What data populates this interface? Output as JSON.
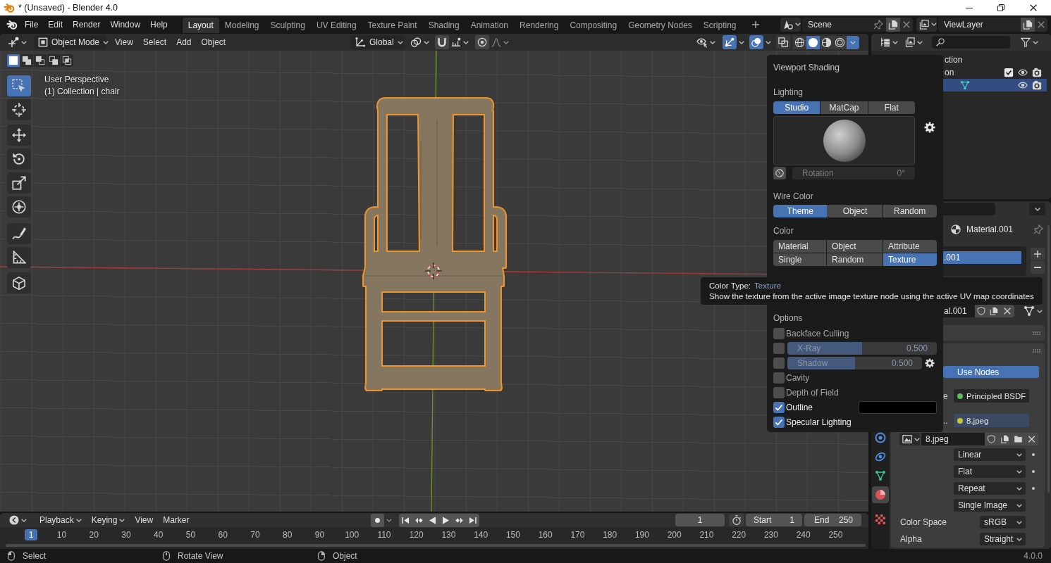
{
  "window": {
    "title": "* (Unsaved) - Blender 4.0"
  },
  "menus": [
    "File",
    "Edit",
    "Render",
    "Window",
    "Help"
  ],
  "workspace_tabs": [
    {
      "label": "Layout",
      "selected": true
    },
    {
      "label": "Modeling",
      "selected": false
    },
    {
      "label": "Sculpting",
      "selected": false
    },
    {
      "label": "UV Editing",
      "selected": false
    },
    {
      "label": "Texture Paint",
      "selected": false
    },
    {
      "label": "Shading",
      "selected": false
    },
    {
      "label": "Animation",
      "selected": false
    },
    {
      "label": "Rendering",
      "selected": false
    },
    {
      "label": "Compositing",
      "selected": false
    },
    {
      "label": "Geometry Nodes",
      "selected": false
    },
    {
      "label": "Scripting",
      "selected": false
    }
  ],
  "scene": {
    "value": "Scene"
  },
  "view_layer": {
    "value": "ViewLayer"
  },
  "viewport_header": {
    "mode": "Object Mode",
    "menus": [
      "View",
      "Select",
      "Add",
      "Object"
    ],
    "orientation": "Global",
    "toggles": [
      {
        "kind": "gizmo",
        "on": true
      },
      {
        "kind": "overlays",
        "on": true
      },
      {
        "kind": "xray",
        "on": false
      }
    ],
    "shading_modes": [
      {
        "kind": "wireframe",
        "selected": false
      },
      {
        "kind": "solid",
        "selected": true
      },
      {
        "kind": "material",
        "selected": false
      },
      {
        "kind": "rendered",
        "selected": false
      }
    ],
    "expanded": true
  },
  "viewport": {
    "view_name": "User Perspective",
    "object_info": "(1) Collection | chair",
    "select_modes": [
      {
        "kind": "set",
        "selected": true
      },
      {
        "kind": "extend",
        "selected": false
      },
      {
        "kind": "subtract",
        "selected": false
      },
      {
        "kind": "difference",
        "selected": false
      },
      {
        "kind": "intersect",
        "selected": false
      }
    ],
    "tools": [
      {
        "kind": "select_box",
        "selected": true
      },
      {
        "kind": "cursor",
        "selected": false
      },
      {
        "kind": "move",
        "selected": false
      },
      {
        "kind": "rotate",
        "selected": false
      },
      {
        "kind": "scale",
        "selected": false
      },
      {
        "kind": "transform",
        "selected": false
      },
      {
        "kind": "annotate",
        "selected": false
      },
      {
        "kind": "measure",
        "selected": false
      },
      {
        "kind": "add_cube",
        "selected": false
      }
    ]
  },
  "viewport_shading": {
    "title": "Viewport Shading",
    "lighting": {
      "label": "Lighting",
      "options": [
        {
          "label": "Studio",
          "selected": true
        },
        {
          "label": "MatCap",
          "selected": false
        },
        {
          "label": "Flat",
          "selected": false
        }
      ],
      "rotation": {
        "label": "Rotation",
        "value": "0°"
      }
    },
    "wire_color": {
      "label": "Wire Color",
      "options": [
        {
          "label": "Theme",
          "selected": true
        },
        {
          "label": "Object",
          "selected": false
        },
        {
          "label": "Random",
          "selected": false
        }
      ]
    },
    "color": {
      "label": "Color",
      "options": [
        {
          "label": "Material",
          "selected": false
        },
        {
          "label": "Object",
          "selected": false
        },
        {
          "label": "Attribute",
          "selected": false
        },
        {
          "label": "Single",
          "selected": false
        },
        {
          "label": "Random",
          "selected": false
        },
        {
          "label": "Texture",
          "selected": true
        }
      ]
    },
    "options": {
      "label": "Options",
      "items": [
        {
          "kind": "checkbox",
          "label": "Backface Culling",
          "checked": false
        },
        {
          "kind": "slider",
          "label": "X-Ray",
          "checked": false,
          "level": 0.5,
          "value": "0.500",
          "settings": false
        },
        {
          "kind": "slider",
          "label": "Shadow",
          "checked": false,
          "level": 0.5,
          "value": "0.500",
          "settings": true
        },
        {
          "kind": "checkbox",
          "label": "Cavity",
          "checked": false
        },
        {
          "kind": "checkbox",
          "label": "Depth of Field",
          "checked": false
        },
        {
          "kind": "color",
          "label": "Outline",
          "checked": true,
          "color": "#000000"
        },
        {
          "kind": "checkbox",
          "label": "Specular Lighting",
          "checked": true
        }
      ]
    }
  },
  "tooltip": {
    "title": "Color Type:",
    "value": "Texture",
    "description": "Show the texture from the active image texture node using the active UV map coordinates"
  },
  "outliner": {
    "rows": [
      {
        "kind": "scene_collection",
        "label": "ction",
        "selected": false
      },
      {
        "kind": "collection",
        "label": "on",
        "selected": false,
        "checked": true
      },
      {
        "kind": "object",
        "selected": true
      }
    ]
  },
  "properties": {
    "tabs": [
      {
        "kind": "physics",
        "selected": false
      },
      {
        "kind": "constraints",
        "selected": false
      },
      {
        "kind": "data",
        "selected": false
      },
      {
        "kind": "material",
        "selected": true
      },
      {
        "kind": "texture",
        "selected": false
      }
    ],
    "material": "Material.001",
    "slots": [
      {
        "label": ".001",
        "selected": true
      }
    ],
    "datablock": "al.001",
    "use_nodes": {
      "label": "Use Nodes",
      "on": true
    },
    "sockets": [
      {
        "label": "e",
        "value": "Principled BSDF",
        "color": "#5dbd5d",
        "selected": false
      },
      {
        "label": "..",
        "value": "8.jpeg",
        "color": "#c7c729",
        "selected": true
      }
    ],
    "image": "8.jpeg",
    "image_settings": [
      {
        "kind": "dropdown",
        "value": "Linear",
        "decorator": true
      },
      {
        "kind": "dropdown",
        "value": "Flat",
        "decorator": true
      },
      {
        "kind": "dropdown",
        "value": "Repeat",
        "decorator": true
      },
      {
        "kind": "dropdown",
        "value": "Single Image",
        "decorator": false
      },
      {
        "kind": "labeled",
        "label": "Color Space",
        "value": "sRGB",
        "decorator": false
      },
      {
        "kind": "labeled",
        "label": "Alpha",
        "value": "Straight",
        "decorator": false
      }
    ]
  },
  "timeline": {
    "menus": [
      {
        "label": "Playback",
        "kind": "dropdown"
      },
      {
        "label": "Keying",
        "kind": "dropdown"
      },
      {
        "label": "View",
        "kind": "menu"
      },
      {
        "label": "Marker",
        "kind": "menu"
      }
    ],
    "current_frame": "1",
    "start": {
      "label": "Start",
      "value": "1"
    },
    "end": {
      "label": "End",
      "value": "250"
    },
    "frames": [
      {
        "label": "1",
        "selected": true
      },
      {
        "label": "10",
        "selected": false
      },
      {
        "label": "20",
        "selected": false
      },
      {
        "label": "30",
        "selected": false
      },
      {
        "label": "40",
        "selected": false
      },
      {
        "label": "50",
        "selected": false
      },
      {
        "label": "60",
        "selected": false
      },
      {
        "label": "70",
        "selected": false
      },
      {
        "label": "80",
        "selected": false
      },
      {
        "label": "90",
        "selected": false
      },
      {
        "label": "100",
        "selected": false
      },
      {
        "label": "110",
        "selected": false
      },
      {
        "label": "120",
        "selected": false
      },
      {
        "label": "130",
        "selected": false
      },
      {
        "label": "140",
        "selected": false
      },
      {
        "label": "150",
        "selected": false
      },
      {
        "label": "160",
        "selected": false
      },
      {
        "label": "170",
        "selected": false
      },
      {
        "label": "180",
        "selected": false
      },
      {
        "label": "190",
        "selected": false
      },
      {
        "label": "200",
        "selected": false
      },
      {
        "label": "210",
        "selected": false
      },
      {
        "label": "220",
        "selected": false
      },
      {
        "label": "230",
        "selected": false
      },
      {
        "label": "240",
        "selected": false
      },
      {
        "label": "250",
        "selected": false
      }
    ]
  },
  "status_bar": {
    "hints": [
      {
        "kind": "left",
        "label": "Select"
      },
      {
        "kind": "middle",
        "label": "Rotate View"
      },
      {
        "kind": "right",
        "label": "Object"
      }
    ],
    "version": "4.0.0"
  }
}
